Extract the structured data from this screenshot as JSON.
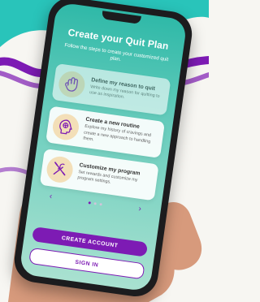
{
  "header": {
    "title": "Create your Quit Plan",
    "subtitle": "Follow the steps to create your customized quit plan."
  },
  "cards": [
    {
      "title": "Define my reason to quit",
      "description": "Write down my reason for quitting to use as inspiration.",
      "icon": "hand-icon"
    },
    {
      "title": "Create a new routine",
      "description": "Explore my history of cravings and create a new approach to handling them.",
      "icon": "head-icon"
    },
    {
      "title": "Customize my program",
      "description": "Set rewards and customize my program settings.",
      "icon": "tools-icon"
    }
  ],
  "pager": {
    "left_arrow": "‹",
    "right_arrow": "›"
  },
  "actions": {
    "create_account": "CREATE ACCOUNT",
    "sign_in": "SIGN IN"
  },
  "colors": {
    "accent": "#7d1bb4",
    "screen_top": "#2fb9a8",
    "screen_bottom": "#a9e1d0"
  }
}
